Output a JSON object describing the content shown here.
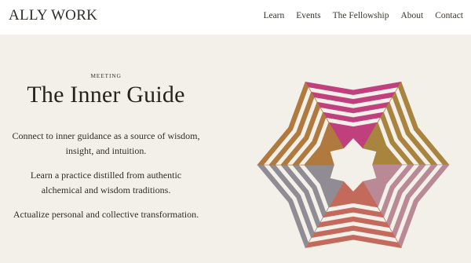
{
  "brand": {
    "name": "ALLY WORK"
  },
  "nav": {
    "items": [
      {
        "label": "Learn"
      },
      {
        "label": "Events"
      },
      {
        "label": "The Fellowship"
      },
      {
        "label": "About"
      },
      {
        "label": "Contact"
      }
    ]
  },
  "hero": {
    "eyebrow": "MEETING",
    "title": "The Inner Guide",
    "paragraph1_line1": "Connect to inner guidance as a source of wisdom,",
    "paragraph1_line2": "insight, and intuition.",
    "paragraph2_line1": "Learn a practice distilled from authentic",
    "paragraph2_line2": "alchemical and wisdom traditions.",
    "paragraph3": "Actualize personal and collective transformation."
  },
  "artwork": {
    "colors": {
      "magenta": "#c0407e",
      "ochre": "#a8843e",
      "mauve": "#b98a95",
      "rose": "#c46a5c",
      "grey": "#8f8c93",
      "brown": "#b07a3e"
    }
  }
}
